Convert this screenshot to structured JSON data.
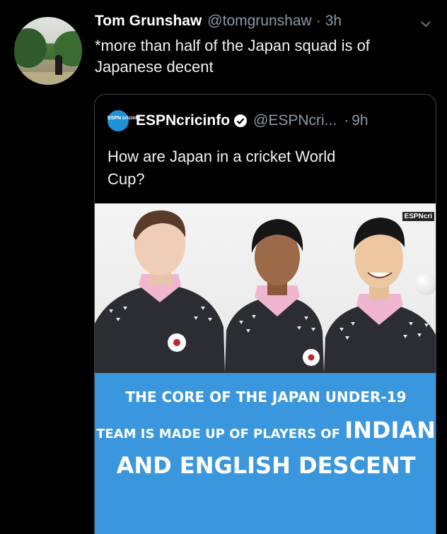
{
  "tweet": {
    "name": "Tom Grunshaw",
    "handle": "@tomgrunshaw",
    "separator": "·",
    "time": "3h",
    "text_line1": "*more than half of the Japan squad is of",
    "text_line2": "Japanese decent",
    "menu_icon": "chevron-down-icon"
  },
  "quoted": {
    "logo_text": "ESPN cricinfo",
    "name": "ESPNcricinfo",
    "handle": "@ESPNcri...",
    "separator": "·",
    "time": "9h",
    "text_line1": "How are Japan in a cricket World",
    "text_line2": "Cup?",
    "verified_icon": "verified-badge-icon",
    "media": {
      "watermark": "ESPNcri",
      "banner_line1": "THE CORE OF THE JAPAN UNDER-19",
      "banner_line2_small": "TEAM IS MADE UP OF PLAYERS OF",
      "banner_line2_big": "INDIAN",
      "banner_line3": "AND ENGLISH DESCENT"
    }
  },
  "colors": {
    "background": "#000000",
    "secondary_text": "#8b98a5",
    "banner": "#3b97dd",
    "quote_border": "#3d4448"
  }
}
